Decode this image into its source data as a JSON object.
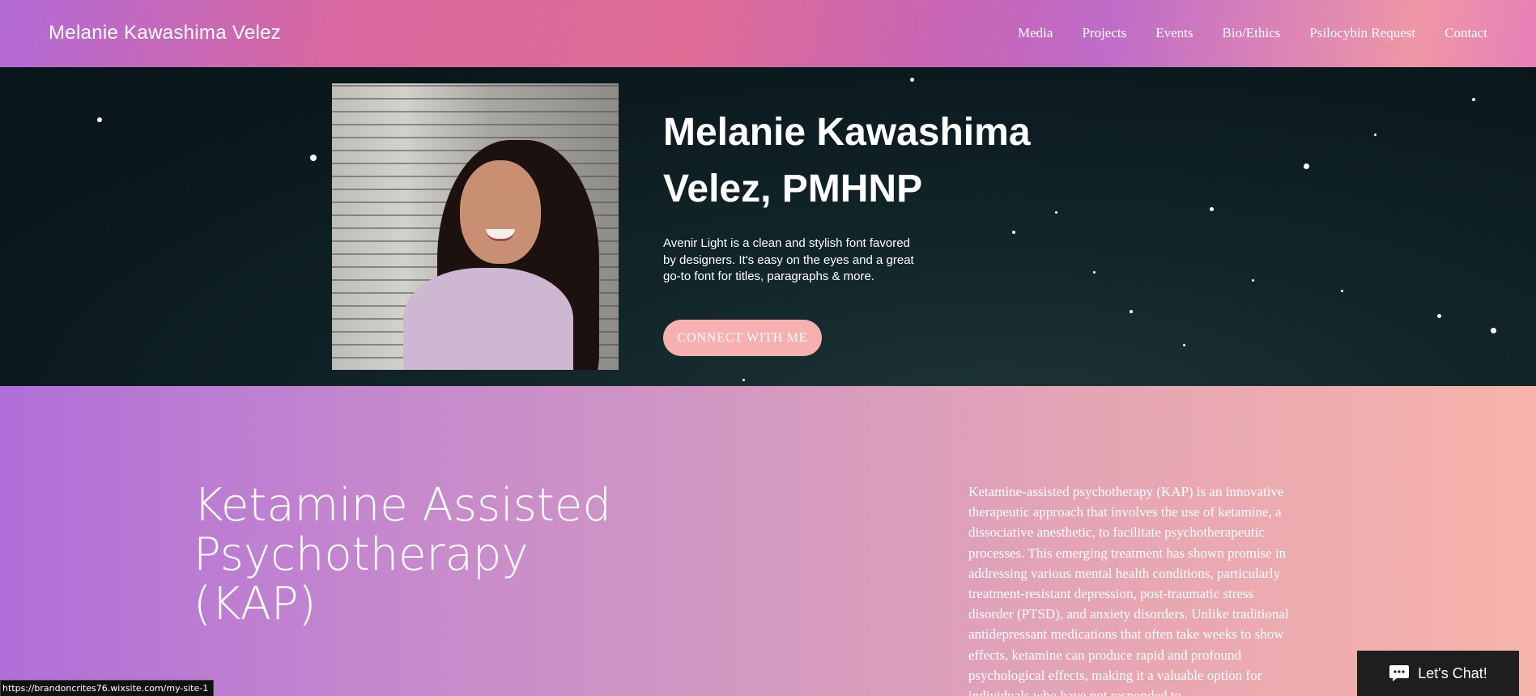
{
  "header": {
    "site_title": "Melanie Kawashima Velez",
    "nav": [
      "Media",
      "Projects",
      "Events",
      "Bio/Ethics",
      "Psilocybin Request",
      "Contact"
    ]
  },
  "hero": {
    "title": "Melanie Kawashima Velez, PMHNP",
    "text": "Avenir Light is a clean and stylish font favored by designers. It's easy on the eyes and a great go-to font for titles, paragraphs & more.",
    "cta": "CONNECT WITH ME"
  },
  "kap": {
    "title": "Ketamine Assisted Psychotherapy (KAP)",
    "text": "Ketamine-assisted psychotherapy (KAP) is an innovative therapeutic approach that involves the use of ketamine, a dissociative anesthetic, to facilitate psychotherapeutic processes. This emerging treatment has shown promise in addressing various mental health conditions, particularly treatment-resistant depression, post-traumatic stress disorder (PTSD), and anxiety disorders. Unlike traditional antidepressant medications that often take weeks to show effects, ketamine can produce rapid and profound psychological effects, making it a valuable option for individuals who have not responded to"
  },
  "status_url": "https://brandoncrites76.wixsite.com/my-site-1",
  "chat": {
    "label": "Let's Chat!"
  },
  "colors": {
    "cta_bg": "#f7b0b0",
    "hero_bg": "#0b1a1e",
    "chat_bg": "#1e1e1e"
  }
}
